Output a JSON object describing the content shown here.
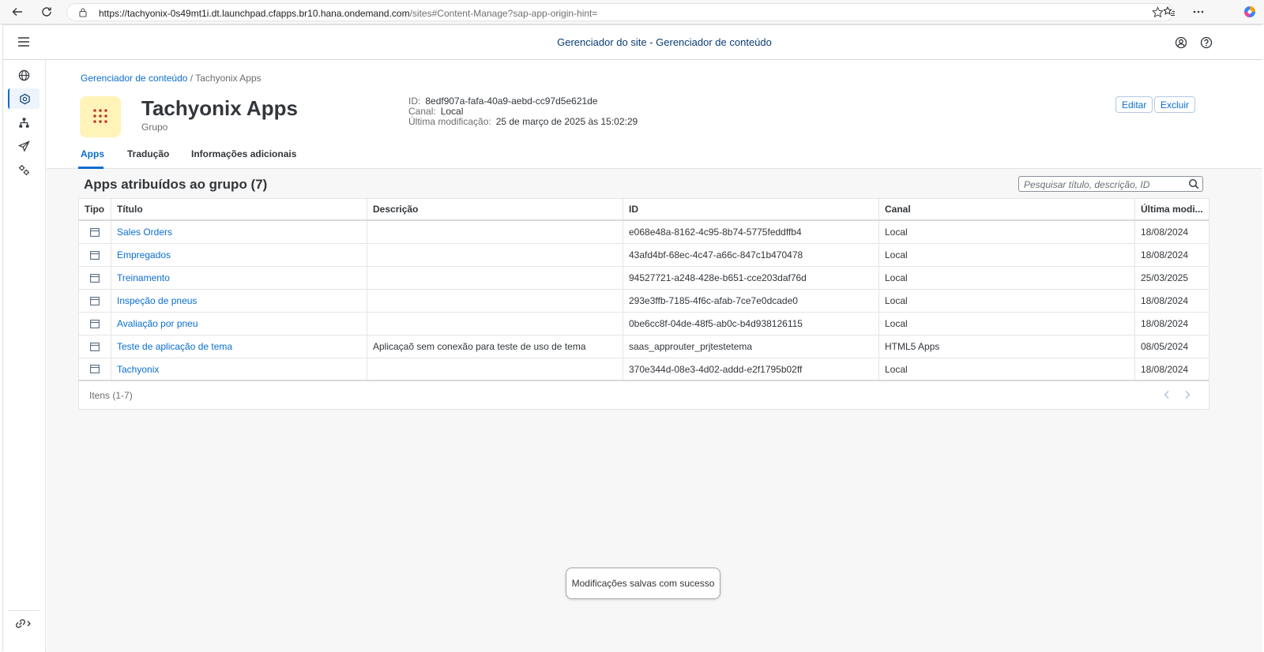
{
  "browser": {
    "url_host": "https://tachyonix-0s49mt1i.dt.launchpad.cfapps.br10.hana.ondemand.com",
    "url_path": "/sites#Content-Manage?sap-app-origin-hint="
  },
  "shell": {
    "title": "Gerenciador do site - Gerenciador de conteúdo"
  },
  "breadcrumb": {
    "link": "Gerenciador de conteúdo",
    "current": "/ Tachyonix Apps"
  },
  "object": {
    "title": "Tachyonix Apps",
    "subtitle": "Grupo",
    "id_label": "ID:",
    "id_value": "8edf907a-fafa-40a9-aebd-cc97d5e621de",
    "channel_label": "Canal:",
    "channel_value": "Local",
    "modified_label": "Última modificação:",
    "modified_value": "25 de março de 2025 às 15:02:29",
    "edit_label": "Editar",
    "delete_label": "Excluir",
    "tile_color": "#fff3b8"
  },
  "tabs": [
    {
      "label": "Apps"
    },
    {
      "label": "Tradução"
    },
    {
      "label": "Informações adicionais"
    }
  ],
  "section": {
    "title": "Apps atribuídos ao grupo (7)",
    "search_placeholder": "Pesquisar título, descrição, ID"
  },
  "table": {
    "headers": [
      "Tipo",
      "Título",
      "Descrição",
      "ID",
      "Canal",
      "Última modi..."
    ],
    "rows": [
      {
        "title": "Sales Orders",
        "description": "",
        "id": "e068e48a-8162-4c95-8b74-5775feddffb4",
        "channel": "Local",
        "modified": "18/08/2024"
      },
      {
        "title": "Empregados",
        "description": "",
        "id": "43afd4bf-68ec-4c47-a66c-847c1b470478",
        "channel": "Local",
        "modified": "18/08/2024"
      },
      {
        "title": "Treinamento",
        "description": "",
        "id": "94527721-a248-428e-b651-cce203daf76d",
        "channel": "Local",
        "modified": "25/03/2025"
      },
      {
        "title": "Inspeção de pneus",
        "description": "",
        "id": "293e3ffb-7185-4f6c-afab-7ce7e0dcade0",
        "channel": "Local",
        "modified": "18/08/2024"
      },
      {
        "title": "Avaliação por pneu",
        "description": "",
        "id": "0be6cc8f-04de-48f5-ab0c-b4d938126115",
        "channel": "Local",
        "modified": "18/08/2024"
      },
      {
        "title": "Teste de aplicação de tema",
        "description": "Aplicaçaõ sem conexão para teste de uso de tema",
        "id": "saas_approuter_prjtestetema",
        "channel": "HTML5 Apps",
        "modified": "08/05/2024"
      },
      {
        "title": "Tachyonix",
        "description": "",
        "id": "370e344d-08e3-4d02-addd-e2f1795b02ff",
        "channel": "Local",
        "modified": "18/08/2024"
      }
    ],
    "footer": "Itens (1-7)"
  },
  "toast": {
    "message": "Modificações salvas com sucesso"
  },
  "colors": {
    "accent": "#0a6ed1",
    "shell_title": "#0a3c73"
  }
}
